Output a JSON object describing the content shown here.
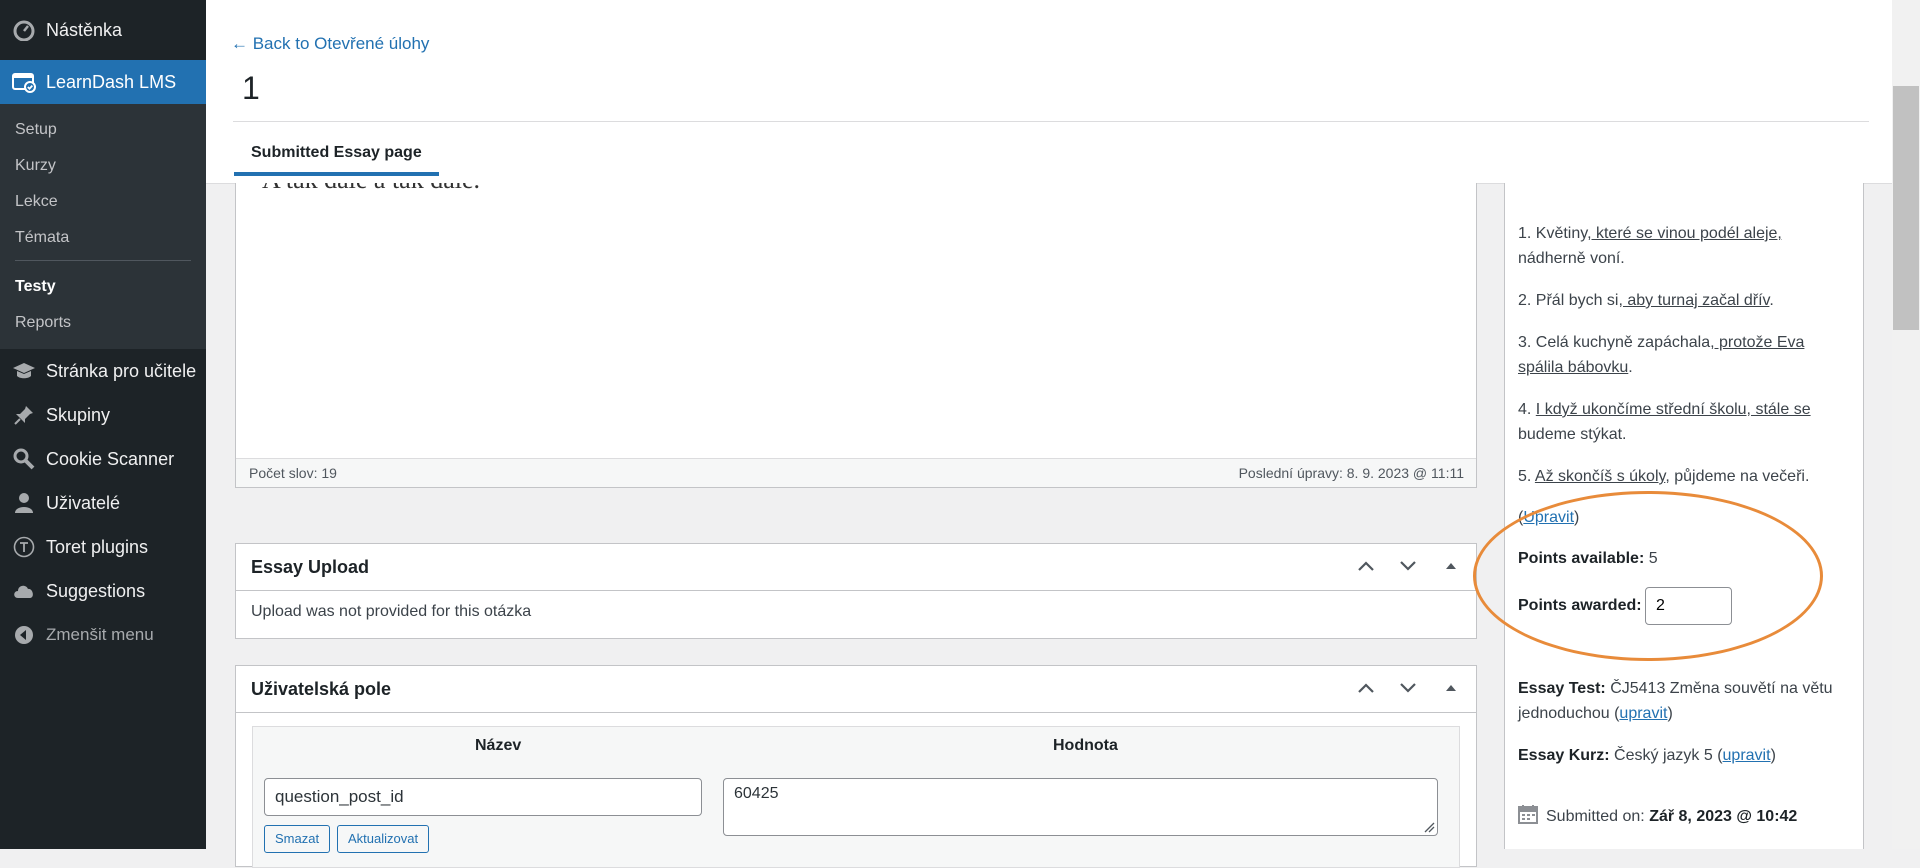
{
  "sidebar": {
    "items_top": [
      {
        "label": "Nástěnka",
        "icon": "dashboard-icon"
      },
      {
        "label": "LearnDash LMS",
        "icon": "learndash-icon"
      }
    ],
    "submenu": [
      "Setup",
      "Kurzy",
      "Lekce",
      "Témata",
      "Testy",
      "Reports"
    ],
    "current_submenu": "Testy",
    "items_bottom": [
      {
        "label": "Stránka pro učitele",
        "icon": "graduation-cap-icon"
      },
      {
        "label": "Skupiny",
        "icon": "pin-icon"
      },
      {
        "label": "Cookie Scanner",
        "icon": "magnifier-icon"
      },
      {
        "label": "Uživatelé",
        "icon": "user-icon"
      },
      {
        "label": "Toret plugins",
        "icon": "toret-icon"
      },
      {
        "label": "Suggestions",
        "icon": "cloud-icon"
      },
      {
        "label": "Zmenšit menu",
        "icon": "collapse-icon"
      }
    ]
  },
  "header": {
    "back_link": "← Back to Otevřené úlohy",
    "title": "1",
    "tab": "Submitted Essay page"
  },
  "editor": {
    "visible_text": "A tak dále a tak dále.",
    "word_count": "Počet slov: 19",
    "last_edit": "Poslední úpravy: 8. 9. 2023 @ 11:11"
  },
  "essay_upload": {
    "title": "Essay Upload",
    "body": "Upload was not provided for this otázka"
  },
  "custom_fields": {
    "title": "Uživatelská pole",
    "col_name": "Název",
    "col_value": "Hodnota",
    "name_value": "question_post_id",
    "value_value": "60425",
    "delete_btn": "Smazat",
    "update_btn": "Aktualizovat"
  },
  "side": {
    "answers": [
      {
        "num": "1. Květiny",
        "u": ", které se vinou podél aleje,",
        "rest": " nádherně voní."
      },
      {
        "num": "2. Přál bych si",
        "u": ", aby turnaj začal dřív",
        "rest": "."
      },
      {
        "num": "3. Celá kuchyně zapáchala",
        "u": ", protože Eva spálila bábovku",
        "rest": "."
      },
      {
        "num": "4. ",
        "u": "I když ukončíme střední školu, stále se",
        "rest": " budeme stýkat."
      },
      {
        "num": "5. ",
        "u": "Až skončíš s úkoly",
        "rest": ", půjdeme na večeři."
      }
    ],
    "edit_link": "Upravit",
    "points_available_label": "Points available:",
    "points_available": "5",
    "points_awarded_label": "Points awarded:",
    "points_awarded": "2",
    "essay_test_label": "Essay Test:",
    "essay_test": "ČJ5413 Změna souvětí na větu jednoduchou",
    "essay_kurz_label": "Essay Kurz:",
    "essay_kurz": "Český jazyk 5",
    "edit_small": "upravit",
    "submitted_label": "Submitted on:",
    "submitted_date": "Zář 8, 2023 @ 10:42"
  },
  "colors": {
    "accent": "#2271b1",
    "sidebar_bg": "#1d2327",
    "highlight": "#e88b3a"
  }
}
